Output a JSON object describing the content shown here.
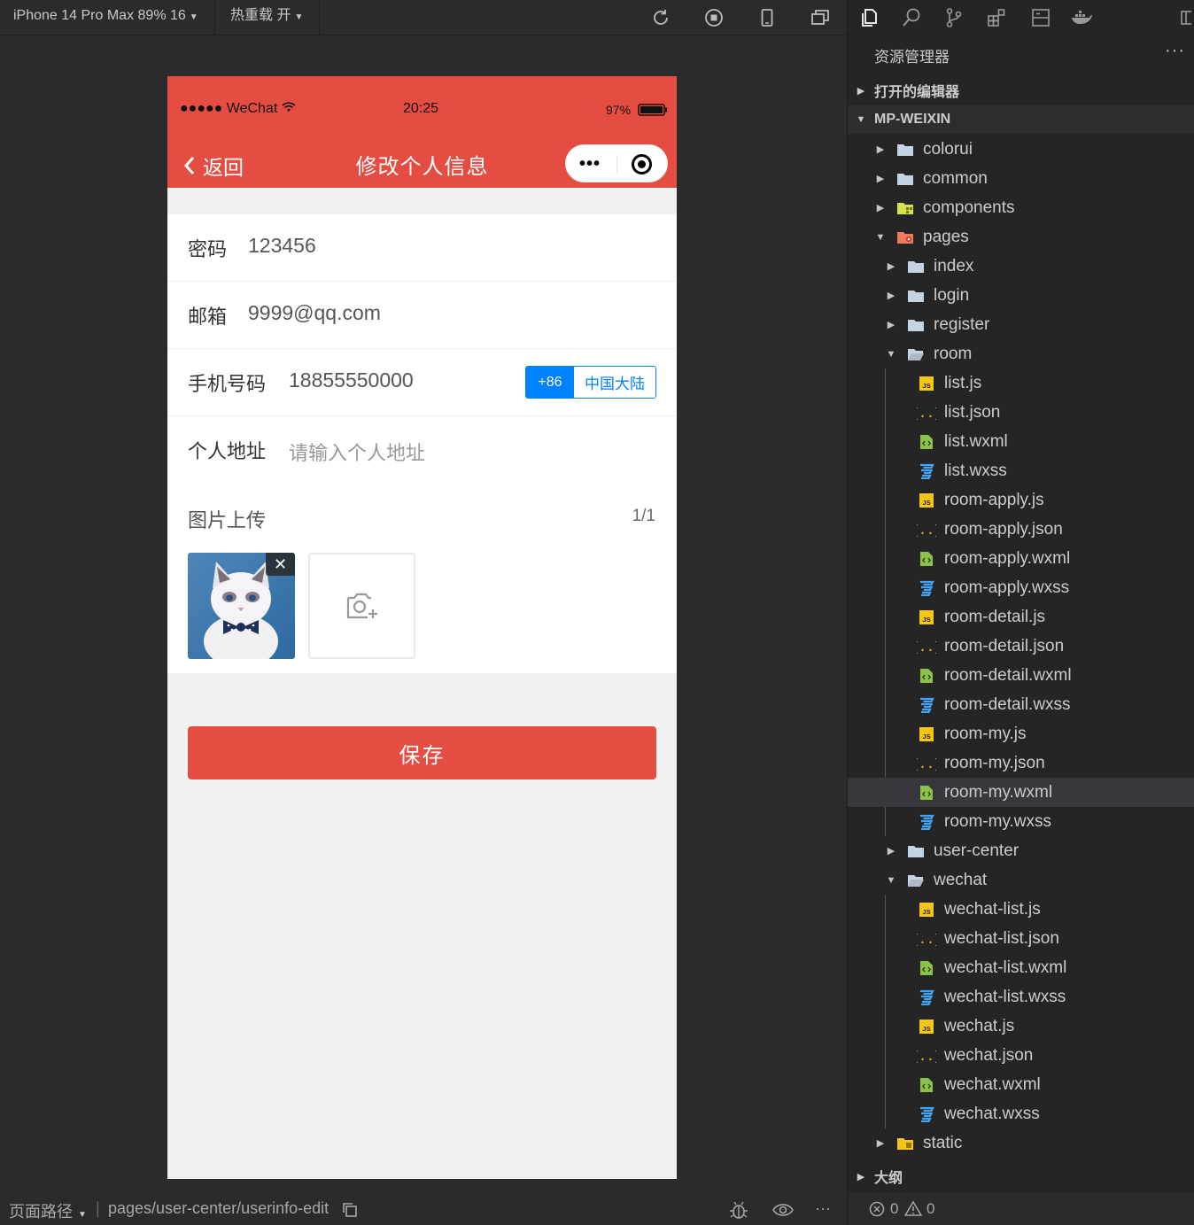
{
  "toolbar": {
    "device": "iPhone 14 Pro Max 89% 16",
    "hot_reload": "热重载 开"
  },
  "phone": {
    "status_carrier": "●●●●● WeChat",
    "status_time": "20:25",
    "status_battery": "97%",
    "back_label": "返回",
    "title": "修改个人信息",
    "capsule_menu": "•••",
    "form": {
      "password_label": "密码",
      "password_value": "123456",
      "email_label": "邮箱",
      "email_value": "9999@qq.com",
      "phone_label": "手机号码",
      "phone_value": "18855550000",
      "phone_code": "+86",
      "phone_region": "中国大陆",
      "address_label": "个人地址",
      "address_placeholder": "请输入个人地址",
      "upload_label": "图片上传",
      "upload_count": "1/1",
      "close_symbol": "✕"
    },
    "save_label": "保存"
  },
  "bottom": {
    "path_label": "页面路径",
    "path_value": "pages/user-center/userinfo-edit",
    "more": "···"
  },
  "explorer": {
    "title": "资源管理器",
    "more": "···",
    "open_editors": "打开的编辑器",
    "project": "MP-WEIXIN",
    "outline": "大纲",
    "errors": "0",
    "warnings": "0",
    "tree": [
      {
        "label": "colorui",
        "type": "folder",
        "depth": 0,
        "open": false
      },
      {
        "label": "common",
        "type": "folder",
        "depth": 0,
        "open": false
      },
      {
        "label": "components",
        "type": "folder-components",
        "depth": 0,
        "open": false
      },
      {
        "label": "pages",
        "type": "folder-pages",
        "depth": 0,
        "open": true
      },
      {
        "label": "index",
        "type": "folder",
        "depth": 1,
        "open": false
      },
      {
        "label": "login",
        "type": "folder",
        "depth": 1,
        "open": false
      },
      {
        "label": "register",
        "type": "folder",
        "depth": 1,
        "open": false
      },
      {
        "label": "room",
        "type": "folder",
        "depth": 1,
        "open": true
      },
      {
        "label": "list.js",
        "type": "js",
        "depth": 2
      },
      {
        "label": "list.json",
        "type": "json",
        "depth": 2
      },
      {
        "label": "list.wxml",
        "type": "wxml",
        "depth": 2
      },
      {
        "label": "list.wxss",
        "type": "wxss",
        "depth": 2
      },
      {
        "label": "room-apply.js",
        "type": "js",
        "depth": 2
      },
      {
        "label": "room-apply.json",
        "type": "json",
        "depth": 2
      },
      {
        "label": "room-apply.wxml",
        "type": "wxml",
        "depth": 2
      },
      {
        "label": "room-apply.wxss",
        "type": "wxss",
        "depth": 2
      },
      {
        "label": "room-detail.js",
        "type": "js",
        "depth": 2
      },
      {
        "label": "room-detail.json",
        "type": "json",
        "depth": 2
      },
      {
        "label": "room-detail.wxml",
        "type": "wxml",
        "depth": 2
      },
      {
        "label": "room-detail.wxss",
        "type": "wxss",
        "depth": 2
      },
      {
        "label": "room-my.js",
        "type": "js",
        "depth": 2
      },
      {
        "label": "room-my.json",
        "type": "json",
        "depth": 2
      },
      {
        "label": "room-my.wxml",
        "type": "wxml",
        "depth": 2,
        "selected": true
      },
      {
        "label": "room-my.wxss",
        "type": "wxss",
        "depth": 2
      },
      {
        "label": "user-center",
        "type": "folder",
        "depth": 1,
        "open": false
      },
      {
        "label": "wechat",
        "type": "folder",
        "depth": 1,
        "open": true
      },
      {
        "label": "wechat-list.js",
        "type": "js",
        "depth": 2
      },
      {
        "label": "wechat-list.json",
        "type": "json",
        "depth": 2
      },
      {
        "label": "wechat-list.wxml",
        "type": "wxml",
        "depth": 2
      },
      {
        "label": "wechat-list.wxss",
        "type": "wxss",
        "depth": 2
      },
      {
        "label": "wechat.js",
        "type": "js",
        "depth": 2
      },
      {
        "label": "wechat.json",
        "type": "json",
        "depth": 2
      },
      {
        "label": "wechat.wxml",
        "type": "wxml",
        "depth": 2
      },
      {
        "label": "wechat.wxss",
        "type": "wxss",
        "depth": 2
      },
      {
        "label": "static",
        "type": "folder-static",
        "depth": 0,
        "open": false
      }
    ]
  },
  "colors": {
    "accent_red": "#e54d42",
    "accent_blue": "#0081ff",
    "js": "#f5c518",
    "json": "#f5c518",
    "wxml": "#8bc34a",
    "wxss": "#42a5f5",
    "folder": "#c5d4e3"
  }
}
